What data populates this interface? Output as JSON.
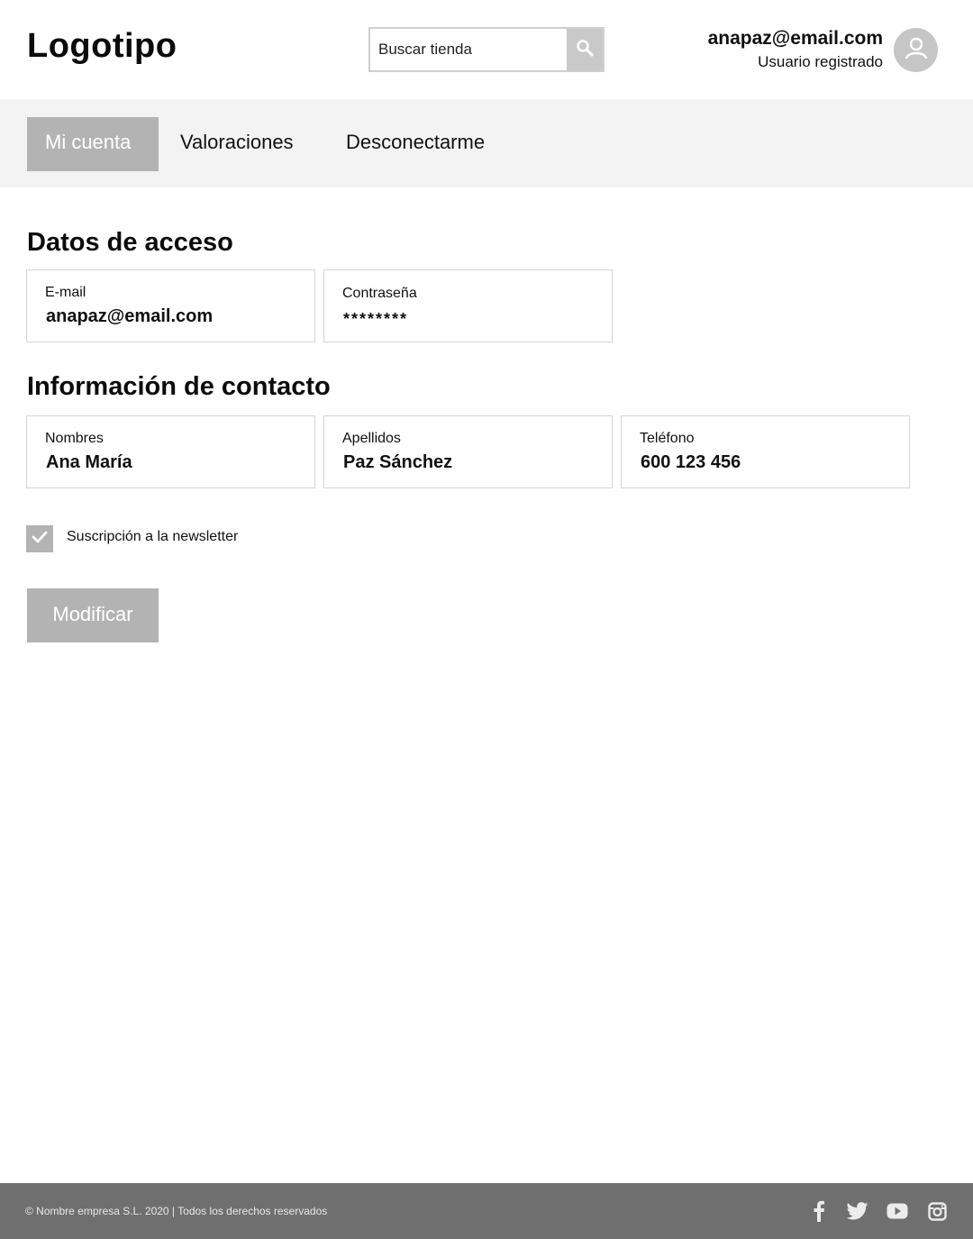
{
  "header": {
    "logo": "Logotipo",
    "search_placeholder": "Buscar tienda",
    "user_email": "anapaz@email.com",
    "user_role": "Usuario registrado"
  },
  "nav": {
    "tabs": [
      {
        "label": "Mi cuenta",
        "active": true
      },
      {
        "label": "Valoraciones",
        "active": false
      },
      {
        "label": "Desconectarme",
        "active": false
      }
    ]
  },
  "access": {
    "title": "Datos de acceso",
    "email_label": "E-mail",
    "email_value": "anapaz@email.com",
    "password_label": "Contraseña",
    "password_value": "********"
  },
  "contact": {
    "title": "Información de contacto",
    "names_label": "Nombres",
    "names_value": "Ana María",
    "surnames_label": "Apellidos",
    "surnames_value": "Paz Sánchez",
    "phone_label": "Teléfono",
    "phone_value": "600 123 456"
  },
  "newsletter": {
    "label": "Suscripción a la newsletter",
    "checked": true
  },
  "actions": {
    "modify_label": "Modificar"
  },
  "footer": {
    "copyright": "© Nombre empresa S.L. 2020 | Todos los derechos reservados",
    "social_icons": [
      "facebook-icon",
      "twitter-icon",
      "youtube-icon",
      "instagram-icon"
    ]
  },
  "colors": {
    "accent_gray": "#b3b3b3",
    "nav_bg": "#f3f3f3",
    "footer_bg": "#6f6f6f"
  }
}
